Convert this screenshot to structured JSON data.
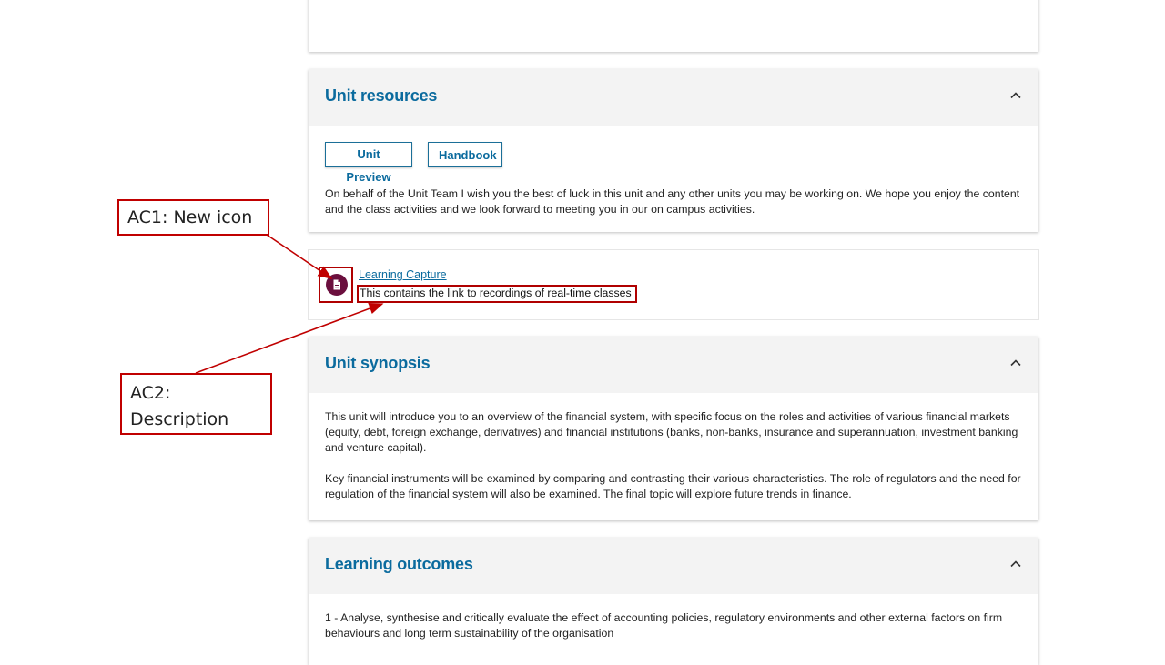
{
  "top_card": {},
  "unit_resources": {
    "title": "Unit resources",
    "buttons": [
      "Unit Preview",
      "Handbook"
    ],
    "text": "On behalf of the Unit Team I wish you the best of luck in this unit and any other units you may be working on. We hope you enjoy the content and the class activities and we look forward to meeting you in our on campus activities."
  },
  "learning_capture": {
    "link": "Learning Capture",
    "description": "This contains the link to recordings of real-time classes",
    "icon": "document-icon",
    "icon_color": "#6b0f3e"
  },
  "unit_synopsis": {
    "title": "Unit synopsis",
    "para1": "This unit will introduce you to an overview of the financial system, with specific focus on the roles and activities of various financial markets (equity, debt, foreign exchange, derivatives) and financial institutions (banks, non-banks, insurance and superannuation, investment banking and venture capital).",
    "para2": "Key financial instruments will be examined by comparing and contrasting their various characteristics. The role of regulators and the need for regulation of the financial system will also be examined.  The final topic will explore future trends in finance."
  },
  "learning_outcomes": {
    "title": "Learning outcomes",
    "item1": "1 - Analyse, synthesise and critically evaluate the effect of accounting policies, regulatory environments and other external factors on firm behaviours and long term sustainability of the organisation"
  },
  "annotations": {
    "ac1": "AC1: New icon",
    "ac2_line1": "AC2:",
    "ac2_line2": "Description"
  },
  "colors": {
    "heading": "#0b6b9e",
    "annotation": "#c00000",
    "header_bg": "#f3f3f3"
  }
}
